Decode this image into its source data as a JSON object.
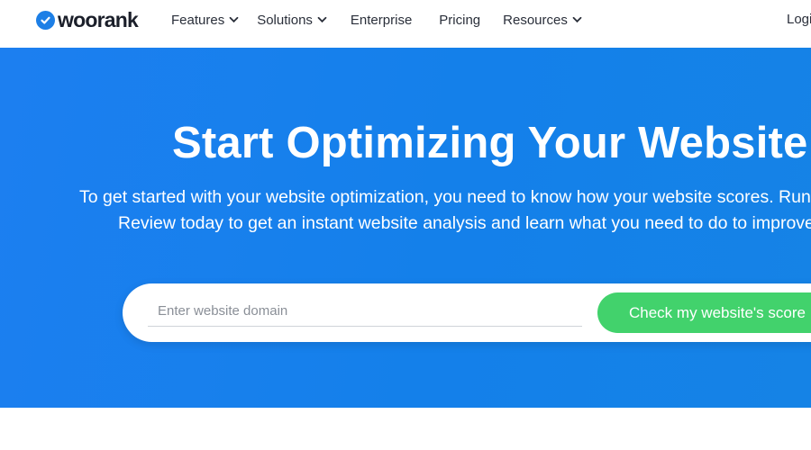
{
  "brand": {
    "name": "woorank",
    "icon": "checkmark-circle-icon",
    "color": "#1d7fe6"
  },
  "nav": {
    "items": [
      {
        "label": "Features",
        "has_dropdown": true
      },
      {
        "label": "Solutions",
        "has_dropdown": true
      },
      {
        "label": "Enterprise",
        "has_dropdown": false
      },
      {
        "label": "Pricing",
        "has_dropdown": false
      },
      {
        "label": "Resources",
        "has_dropdown": true
      }
    ],
    "login_label": "Login"
  },
  "hero": {
    "title": "Start Optimizing Your Website",
    "subtitle_line1": "To get started with your website optimization, you need to know how your website scores. Run a WooRank",
    "subtitle_line2": "Review today to get an instant website analysis and learn what you need to do to improve.",
    "background_color": "#1480ea"
  },
  "search": {
    "placeholder": "Enter website domain",
    "value": "",
    "button_label": "Check my website's score",
    "button_color": "#42d26c"
  }
}
